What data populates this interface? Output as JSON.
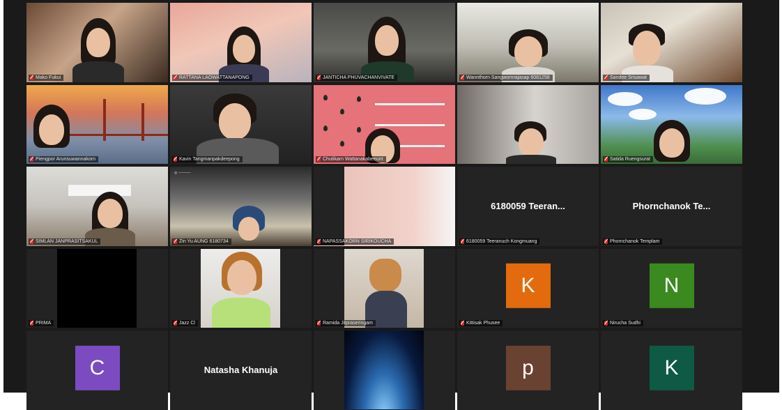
{
  "participants": [
    {
      "name": "Mako Fukui"
    },
    {
      "name": "RATTANA LAOWATTANAPONG"
    },
    {
      "name": "JANTICHA PHUVACHANVIVATE"
    },
    {
      "name": "Wannthorn Sangwornrajasap 6081258"
    },
    {
      "name": "Sandee Srisawat"
    },
    {
      "name": "Piengpor Arunsuwannakorn"
    },
    {
      "name": "Kavin Tangmanpakdeepong"
    },
    {
      "name": "Chutikarn Wattanakabeeunt"
    },
    {
      "name": ""
    },
    {
      "name": "Satida Ruengsurat"
    },
    {
      "name": "SIMLAN JANPRASITSAKUL"
    },
    {
      "name": "Zin Yu AUNG 6180734"
    },
    {
      "name": "NAPASSAKORN SIRIKOUCHA"
    },
    {
      "name": "6180059 Teeranuch Kongmuang",
      "display": "6180059  Teeran..."
    },
    {
      "name": "Phornchanok Templam",
      "display": "Phornchanok  Te..."
    },
    {
      "name": "PRIMA"
    },
    {
      "name": "Jazz Cl"
    },
    {
      "name": "Ramida Jitpraseringam"
    },
    {
      "name": "Kittisak Phusee",
      "initial": "K",
      "color": "#e36b0e"
    },
    {
      "name": "Nirucha Sudhi",
      "initial": "N",
      "color": "#3a8a1f"
    },
    {
      "initial": "C",
      "color": "#7c4bc2"
    },
    {
      "display": "Natasha Khanuja"
    },
    {},
    {
      "initial": "p",
      "color": "#6a4232"
    },
    {
      "initial": "K",
      "color": "#0f5a44"
    }
  ],
  "icons": {
    "muted": "muted-mic-icon"
  }
}
